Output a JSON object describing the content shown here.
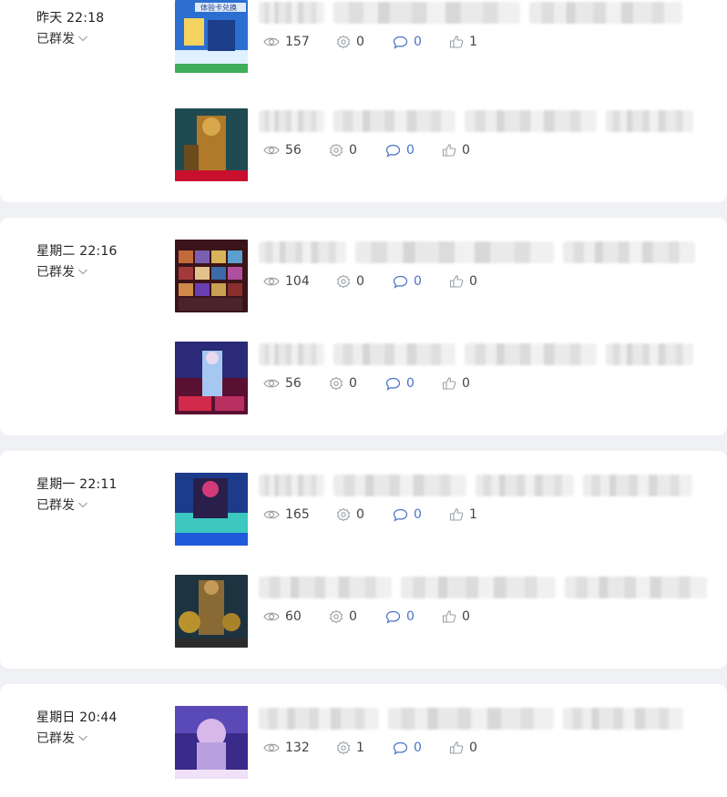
{
  "status_label": "已群发",
  "groups": [
    {
      "time": "昨天 22:18",
      "posts": [
        {
          "thumb_text": "体验卡兑换",
          "views": "157",
          "shares": "0",
          "comments": "0",
          "likes": "1"
        },
        {
          "thumb_text": "",
          "views": "56",
          "shares": "0",
          "comments": "0",
          "likes": "0"
        }
      ]
    },
    {
      "time": "星期二 22:16",
      "posts": [
        {
          "thumb_text": "",
          "views": "104",
          "shares": "0",
          "comments": "0",
          "likes": "0"
        },
        {
          "thumb_text": "",
          "views": "56",
          "shares": "0",
          "comments": "0",
          "likes": "0"
        }
      ]
    },
    {
      "time": "星期一 22:11",
      "posts": [
        {
          "thumb_text": "",
          "views": "165",
          "shares": "0",
          "comments": "0",
          "likes": "1"
        },
        {
          "thumb_text": "",
          "views": "60",
          "shares": "0",
          "comments": "0",
          "likes": "0"
        }
      ]
    },
    {
      "time": "星期日 20:44",
      "posts": [
        {
          "thumb_text": "",
          "views": "132",
          "shares": "1",
          "comments": "0",
          "likes": "0"
        }
      ]
    }
  ],
  "icons": {
    "views": "eye-icon",
    "shares": "share-gear-icon",
    "comments": "comment-bubble-icon",
    "likes": "thumbs-up-icon",
    "status_toggle": "chevron-down-icon"
  },
  "colors": {
    "background": "#f0f1f4",
    "card": "#ffffff",
    "comment_value": "#4b73c8",
    "icon": "#9aa0a6"
  }
}
